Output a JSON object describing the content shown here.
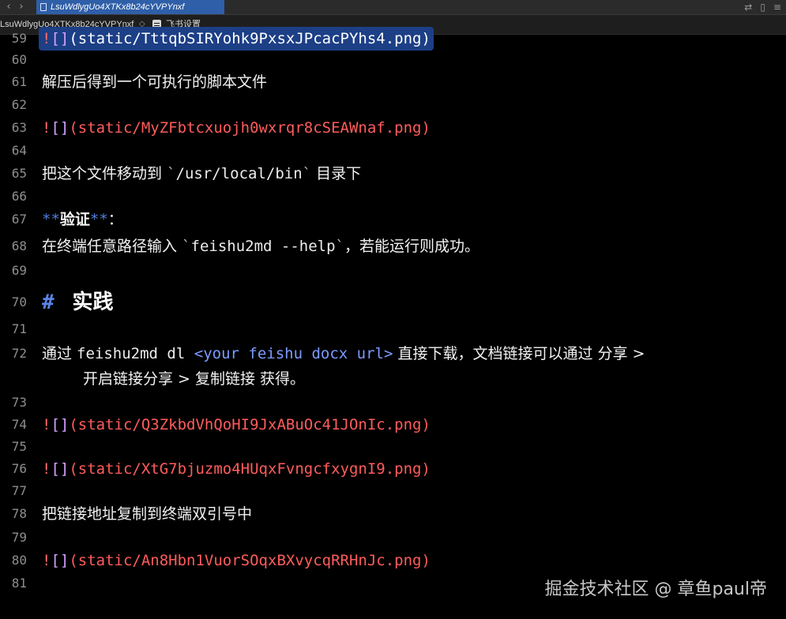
{
  "tab": {
    "title": "LsuWdlygUo4XTKx8b24cYVPYnxf"
  },
  "breadcrumb": {
    "file": "LsuWdlygUo4XTKx8b24cYVPYnxf",
    "heading": "飞书设置"
  },
  "window_icons": [
    "swap-icon",
    "split-icon",
    "more-icon"
  ],
  "lines": {
    "l59": {
      "num": "59",
      "bang": "!",
      "brk": "[]",
      "path": "(static/TttqbSIRYohk9PxsxJPcacPYhs4.png)"
    },
    "l60": {
      "num": "60"
    },
    "l61": {
      "num": "61",
      "text": "解压后得到一个可执行的脚本文件"
    },
    "l62": {
      "num": "62"
    },
    "l63": {
      "num": "63",
      "bang": "!",
      "brk": "[]",
      "path": "(static/MyZFbtcxuojh0wxrqr8cSEAWnaf.png)"
    },
    "l64": {
      "num": "64"
    },
    "l65": {
      "num": "65",
      "pre": "把这个文件移动到 ",
      "tick1": "`",
      "code": "/usr/local/bin",
      "tick2": "`",
      "post": " 目录下"
    },
    "l66": {
      "num": "66"
    },
    "l67": {
      "num": "67",
      "mark1": "**",
      "bold": "验证",
      "mark2": "**",
      "post": "："
    },
    "l68": {
      "num": "68",
      "pre": "在终端任意路径输入 ",
      "tick1": "`",
      "code": "feishu2md --help",
      "tick2": "`",
      "post": "，若能运行则成功。"
    },
    "l69": {
      "num": "69"
    },
    "l70": {
      "num": "70",
      "hash": "#",
      "heading": "实践"
    },
    "l71": {
      "num": "71"
    },
    "l72": {
      "num": "72",
      "pre": "通过 ",
      "cmd": "feishu2md dl ",
      "angle": "<your feishu docx url>",
      "post": " 直接下载，文档链接可以通过 分享 >"
    },
    "l72b": {
      "text": "开启链接分享 > 复制链接 获得。"
    },
    "l73": {
      "num": "73"
    },
    "l74": {
      "num": "74",
      "bang": "!",
      "brk": "[]",
      "path": "(static/Q3ZkbdVhQoHI9JxABuOc41JOnIc.png)"
    },
    "l75": {
      "num": "75"
    },
    "l76": {
      "num": "76",
      "bang": "!",
      "brk": "[]",
      "path": "(static/XtG7bjuzmo4HUqxFvngcfxygnI9.png)"
    },
    "l77": {
      "num": "77"
    },
    "l78": {
      "num": "78",
      "text": "把链接地址复制到终端双引号中"
    },
    "l79": {
      "num": "79"
    },
    "l80": {
      "num": "80",
      "bang": "!",
      "brk": "[]",
      "path": "(static/An8Hbn1VuorSOqxBXvycqRRHnJc.png)"
    },
    "l81": {
      "num": "81"
    }
  },
  "watermark": "掘金技术社区 @ 章鱼paul帝",
  "colors": {
    "background": "#000000",
    "tab_active": "#2f5fa8",
    "image_path": "#ff5c5c",
    "markdown_mark": "#4f7fe0",
    "selection": "#1c3f86"
  }
}
